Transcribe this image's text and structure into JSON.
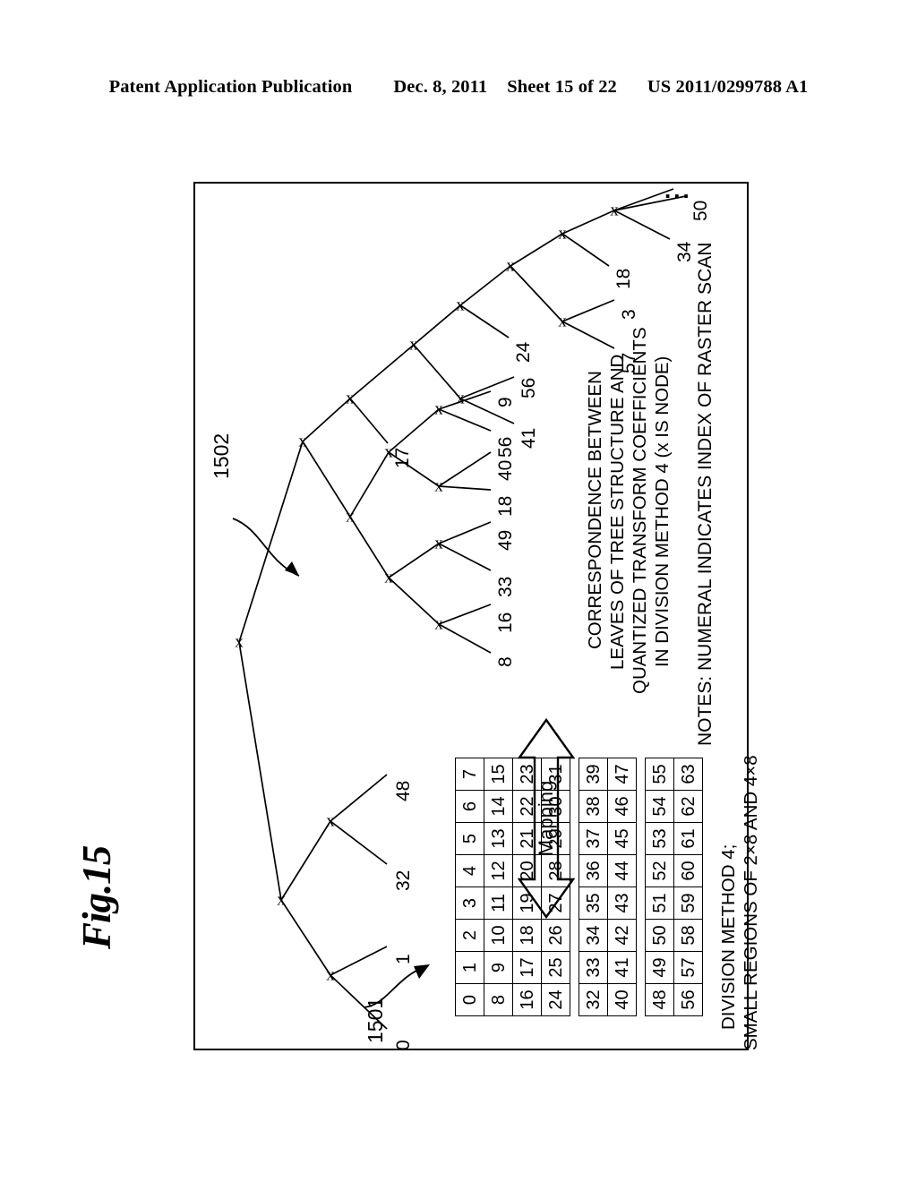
{
  "header": {
    "publication": "Patent Application Publication",
    "date": "Dec. 8, 2011",
    "sheet": "Sheet 15 of 22",
    "number": "US 2011/0299788 A1"
  },
  "figure": {
    "label": "Fig.15",
    "refs": {
      "table_ref": "1501",
      "tree_ref": "1502"
    },
    "node_glyph": "x",
    "ellipsis": "..."
  },
  "tree": {
    "leaf_labels": [
      "0",
      "1",
      "32",
      "48",
      "8",
      "16",
      "33",
      "49",
      "18",
      "40",
      "56",
      "9",
      "17",
      "41",
      "56",
      "24",
      "57",
      "3",
      "18",
      "34",
      "50"
    ],
    "leaves": [
      {
        "id": "leaf-0",
        "text": "0"
      },
      {
        "id": "leaf-1",
        "text": "1"
      },
      {
        "id": "leaf-32",
        "text": "32"
      },
      {
        "id": "leaf-48",
        "text": "48"
      },
      {
        "id": "leaf-8",
        "text": "8"
      },
      {
        "id": "leaf-16",
        "text": "16"
      },
      {
        "id": "leaf-33",
        "text": "33"
      },
      {
        "id": "leaf-49",
        "text": "49"
      },
      {
        "id": "leaf-18a",
        "text": "18"
      },
      {
        "id": "leaf-40",
        "text": "40"
      },
      {
        "id": "leaf-56a",
        "text": "56"
      },
      {
        "id": "leaf-9",
        "text": "9"
      },
      {
        "id": "leaf-17",
        "text": "17"
      },
      {
        "id": "leaf-41",
        "text": "41"
      },
      {
        "id": "leaf-56b",
        "text": "56"
      },
      {
        "id": "leaf-24",
        "text": "24"
      },
      {
        "id": "leaf-57",
        "text": "57"
      },
      {
        "id": "leaf-3",
        "text": "3"
      },
      {
        "id": "leaf-18b",
        "text": "18"
      },
      {
        "id": "leaf-34",
        "text": "34"
      },
      {
        "id": "leaf-50",
        "text": "50"
      }
    ]
  },
  "mapping": {
    "arrow_label": "Mapping"
  },
  "description": {
    "lines": [
      "CORRESPONDENCE BETWEEN",
      "LEAVES OF TREE STRUCTURE AND",
      "QUANTIZED TRANSFORM COEFFICIENTS",
      "IN DIVISION METHOD 4 (x IS NODE)"
    ],
    "notes": "NOTES: NUMERAL INDICATES INDEX OF RASTER SCAN"
  },
  "table": {
    "caption_lines": [
      "DIVISION METHOD 4;",
      "SMALL REGIONS OF 2×8 AND 4×8"
    ],
    "blocks": [
      {
        "name": "block-4x8-top",
        "rows": [
          [
            0,
            1,
            2,
            3,
            4,
            5,
            6,
            7
          ],
          [
            8,
            9,
            10,
            11,
            12,
            13,
            14,
            15
          ],
          [
            16,
            17,
            18,
            19,
            20,
            21,
            22,
            23
          ],
          [
            24,
            25,
            26,
            27,
            28,
            29,
            30,
            31
          ]
        ]
      },
      {
        "name": "block-2x8-middle",
        "rows": [
          [
            32,
            33,
            34,
            35,
            36,
            37,
            38,
            39
          ],
          [
            40,
            41,
            42,
            43,
            44,
            45,
            46,
            47
          ]
        ]
      },
      {
        "name": "block-2x8-bottom",
        "rows": [
          [
            48,
            49,
            50,
            51,
            52,
            53,
            54,
            55
          ],
          [
            56,
            57,
            58,
            59,
            60,
            61,
            62,
            63
          ]
        ]
      }
    ]
  },
  "colors": {
    "ink": "#000000",
    "paper": "#ffffff"
  }
}
